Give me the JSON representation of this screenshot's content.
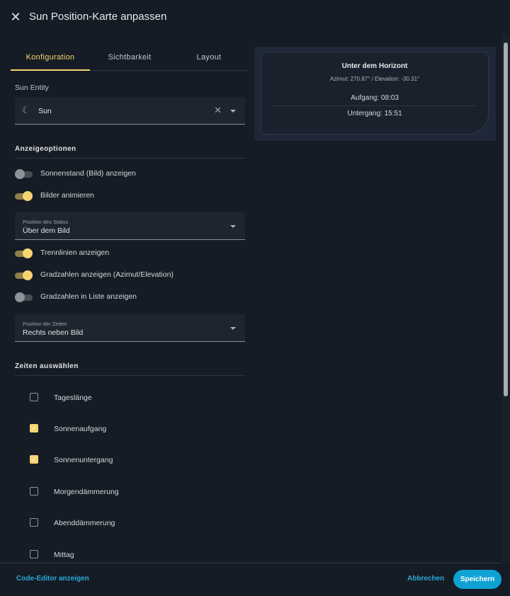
{
  "header": {
    "title": "Sun Position-Karte anpassen",
    "close_icon": "close-icon"
  },
  "tabs": [
    {
      "label": "Konfiguration",
      "active": true
    },
    {
      "label": "Sichtbarkeit",
      "active": false
    },
    {
      "label": "Layout",
      "active": false
    }
  ],
  "entity": {
    "label": "Sun Entity",
    "value": "Sun",
    "icon": "weather-night-icon"
  },
  "display_options": {
    "title": "Anzeigeoptionen"
  },
  "toggles": [
    {
      "label": "Sonnenstand (Bild) anzeigen",
      "on": false
    },
    {
      "label": "Bilder animieren",
      "on": true
    },
    {
      "label": "Trennlinien anzeigen",
      "on": true
    },
    {
      "label": "Gradzahlen anzeigen (Azimut/Elevation)",
      "on": true
    },
    {
      "label": "Gradzahlen in Liste anzeigen",
      "on": false
    }
  ],
  "status_position": {
    "label": "Position des Status",
    "value": "Über dem Bild"
  },
  "times_position": {
    "label": "Position der Zeiten",
    "value": "Rechts neben Bild"
  },
  "times": {
    "title": "Zeiten auswählen",
    "items": [
      {
        "label": "Tageslänge",
        "checked": false
      },
      {
        "label": "Sonnenaufgang",
        "checked": true
      },
      {
        "label": "Sonnenuntergang",
        "checked": true
      },
      {
        "label": "Morgendämmerung",
        "checked": false
      },
      {
        "label": "Abenddämmerung",
        "checked": false
      },
      {
        "label": "Mittag",
        "checked": false
      }
    ]
  },
  "preview": {
    "state": "Unter dem Horizont",
    "position": "Azimut: 270.87° / Elevation: -30.31°",
    "sunrise": "Aufgang: 08:03",
    "sunset": "Untergang: 15:51"
  },
  "footer": {
    "code_editor": "Code-Editor anzeigen",
    "cancel": "Abbrechen",
    "save": "Speichern"
  },
  "colors": {
    "accent": "#f5d571",
    "primary": "#0ea2d4",
    "background": "#161c25"
  }
}
